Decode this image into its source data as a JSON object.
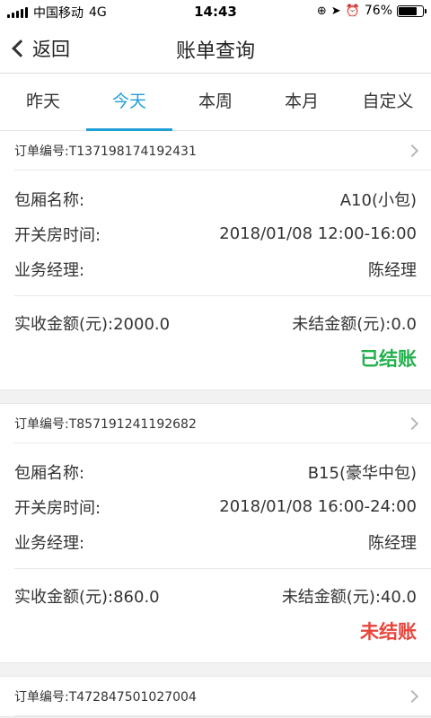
{
  "status_bar": {
    "carrier": "中国移动",
    "network": "4G",
    "time": "14:43",
    "battery": "76%",
    "battery_level": 0.76
  },
  "nav": {
    "back_label": "返回",
    "title": "账单查询"
  },
  "tabs": [
    {
      "label": "昨天",
      "active": false
    },
    {
      "label": "今天",
      "active": true
    },
    {
      "label": "本周",
      "active": false
    },
    {
      "label": "本月",
      "active": false
    },
    {
      "label": "自定义",
      "active": false
    }
  ],
  "labels": {
    "room": "包厢名称:",
    "time": "开关房时间:",
    "manager": "业务经理:"
  },
  "orders": [
    {
      "order_no": "订单编号:T137198174192431",
      "room": "A10(小包)",
      "time": "2018/01/08 12:00-16:00",
      "manager": "陈经理",
      "received": "实收金额(元):2000.0",
      "unsettled": "未结金额(元):0.0",
      "status": "已结账",
      "status_color": "#22b14c"
    },
    {
      "order_no": "订单编号:T857191241192682",
      "room": "B15(豪华中包)",
      "time": "2018/01/08 16:00-24:00",
      "manager": "陈经理",
      "received": "实收金额(元):860.0",
      "unsettled": "未结金额(元):40.0",
      "status": "未结账",
      "status_color": "#e8453c"
    },
    {
      "order_no": "订单编号:T472847501027004"
    }
  ]
}
